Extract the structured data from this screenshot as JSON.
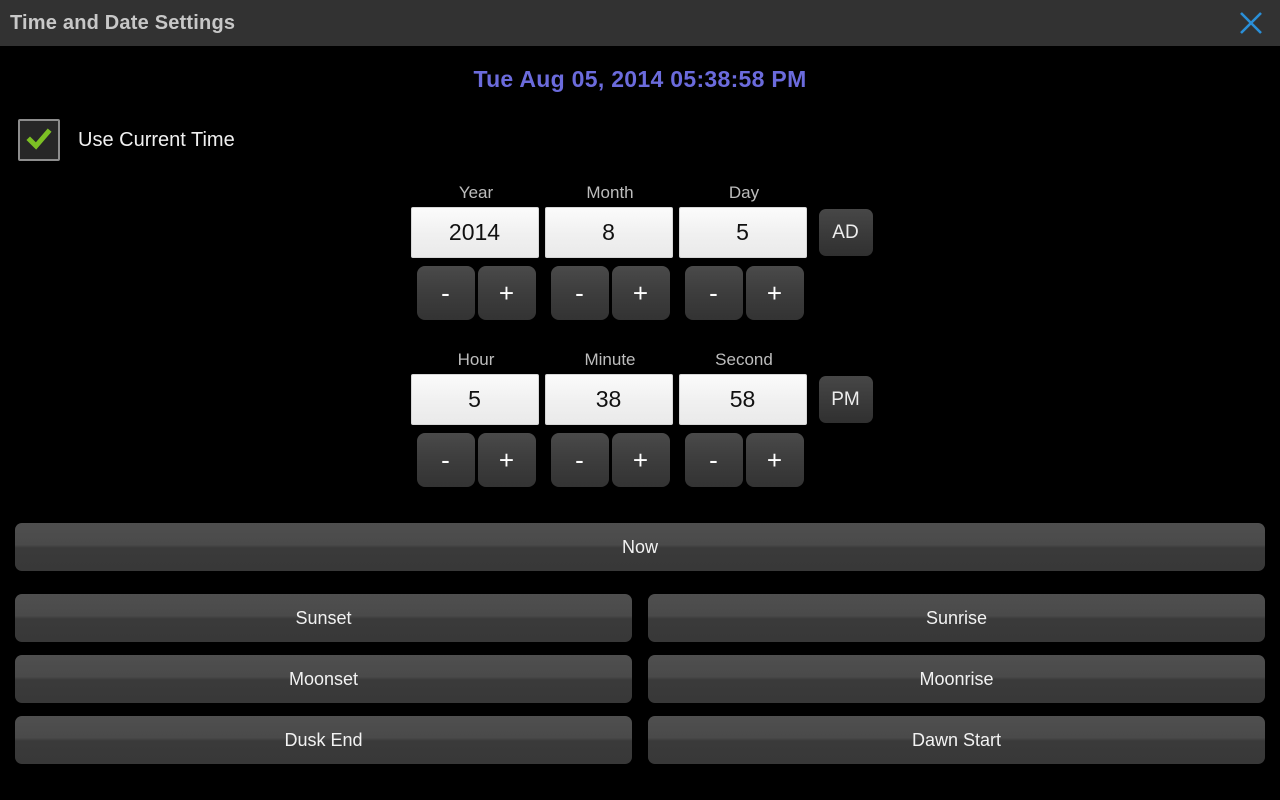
{
  "window": {
    "title": "Time and Date Settings",
    "close_icon": "close-icon",
    "accent_close": "#2a8fd8"
  },
  "header": {
    "current_datetime": "Tue Aug 05, 2014  05:38:58 PM",
    "datetime_color": "#6b6bdc"
  },
  "use_current_time": {
    "label": "Use Current Time",
    "checked": true,
    "check_icon": "check-icon",
    "check_color": "#7cc024"
  },
  "date_group": {
    "labels": [
      "Year",
      "Month",
      "Day"
    ],
    "values": [
      "2014",
      "8",
      "5"
    ],
    "era_button": "AD",
    "stepper_minus": "-",
    "stepper_plus": "+"
  },
  "time_group": {
    "labels": [
      "Hour",
      "Minute",
      "Second"
    ],
    "values": [
      "5",
      "38",
      "58"
    ],
    "ampm_button": "PM",
    "stepper_minus": "-",
    "stepper_plus": "+"
  },
  "now_button": {
    "label": "Now"
  },
  "event_buttons": {
    "rows": [
      {
        "left": "Sunset",
        "right": "Sunrise"
      },
      {
        "left": "Moonset",
        "right": "Moonrise"
      },
      {
        "left": "Dusk End",
        "right": "Dawn Start"
      }
    ]
  }
}
